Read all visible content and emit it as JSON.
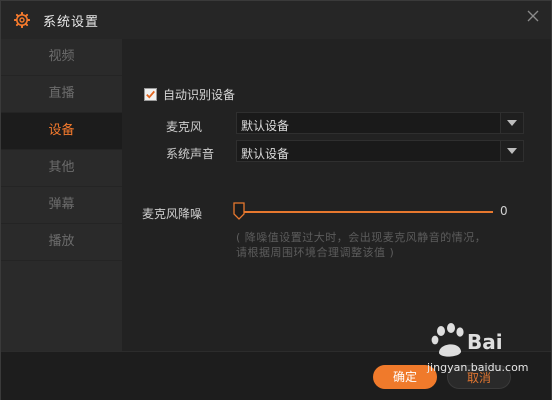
{
  "window": {
    "title": "系统设置"
  },
  "sidebar": {
    "items": [
      {
        "label": "视频",
        "active": false
      },
      {
        "label": "直播",
        "active": false
      },
      {
        "label": "设备",
        "active": true
      },
      {
        "label": "其他",
        "active": false
      },
      {
        "label": "弹幕",
        "active": false
      },
      {
        "label": "播放",
        "active": false
      }
    ]
  },
  "device": {
    "auto_detect_label": "自动识别设备",
    "auto_detect_checked": true,
    "microphone_label": "麦克风",
    "microphone_value": "默认设备",
    "system_audio_label": "系统声音",
    "system_audio_value": "默认设备"
  },
  "noise": {
    "label": "麦克风降噪",
    "value": "0",
    "hint_line1": "( 降噪值设置过大时，会出现麦克风静音的情况，",
    "hint_line2": "请根据周围环境合理调整该值 )"
  },
  "footer": {
    "ok_label": "确定",
    "cancel_label": "取消"
  },
  "watermark": {
    "text": "jingyan.baidu.com"
  },
  "colors": {
    "accent": "#f47a2d",
    "background": "#222222",
    "sidebar": "#2a2a2a"
  }
}
